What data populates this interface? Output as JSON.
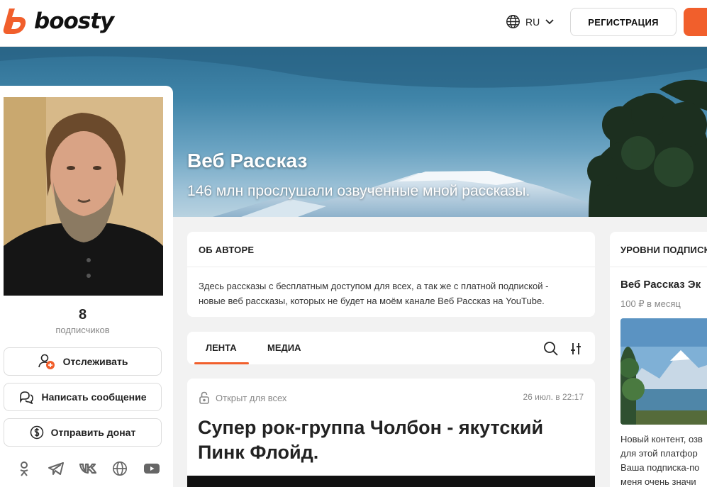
{
  "header": {
    "logo_text": "boosty",
    "language": "RU",
    "register_label": "РЕГИСТРАЦИЯ"
  },
  "cover": {
    "title": "Веб Рассказ",
    "subtitle": "146 млн прослушали озвученные мной рассказы."
  },
  "profile": {
    "subscribers_count": "8",
    "subscribers_label": "подписчиков",
    "follow_label": "Отслеживать",
    "message_label": "Написать сообщение",
    "donate_label": "Отправить донат",
    "socials": [
      "odnoklassniki-icon",
      "telegram-icon",
      "vk-icon",
      "globe-icon",
      "youtube-icon"
    ]
  },
  "about": {
    "title": "ОБ АВТОРЕ",
    "text_line1": "Здесь рассказы с бесплатным доступом для всех, а так же с платной подпиской -",
    "text_line2": "новые веб рассказы, которых не будет на моём канале Веб Рассказ на YouTube."
  },
  "feed": {
    "tabs": [
      {
        "label": "ЛЕНТА",
        "active": true
      },
      {
        "label": "МЕДИА",
        "active": false
      }
    ]
  },
  "post": {
    "access": "Открыт для всех",
    "date": "26 июл. в 22:17",
    "title_line1": "Супер рок-группа Чолбон - якутский",
    "title_line2": "Пинк Флойд."
  },
  "levels": {
    "title": "УРОВНИ ПОДПИСКИ",
    "level_name": "Веб Рассказ Эк",
    "level_price": "100 ₽ в месяц",
    "desc_line1": "Новый контент, озв",
    "desc_line2": "для этой платфор",
    "desc_line3": "Ваша подписка-по",
    "desc_line4": "меня очень значи"
  },
  "colors": {
    "accent": "#f15f2c",
    "background": "#f2f2f2"
  }
}
